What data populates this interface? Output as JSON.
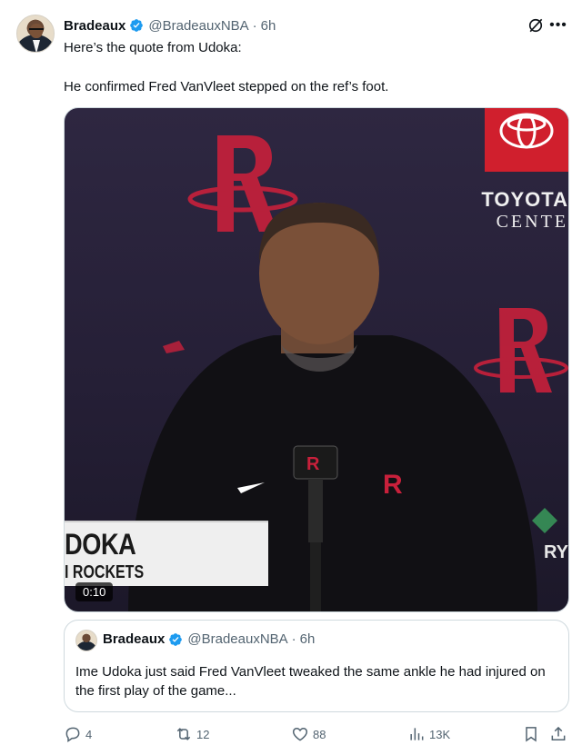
{
  "tweet": {
    "author": {
      "name": "Bradeaux",
      "handle": "@BradeauxNBA",
      "separator": "·",
      "time": "6h"
    },
    "text_line1": "Here’s the quote from Udoka:",
    "text_line2": "He confirmed Fred VanVleet stepped on the ref’s foot.",
    "media": {
      "duration": "0:10",
      "lower_third_name": "DOKA",
      "lower_third_team": "I ROCKETS",
      "sponsor_line1": "TOYOTA",
      "sponsor_line2": "CENTE",
      "right_edge_text": "RY"
    },
    "quote": {
      "name": "Bradeaux",
      "handle": "@BradeauxNBA",
      "separator": "·",
      "time": "6h",
      "text": "Ime Udoka just said Fred VanVleet tweaked the same ankle he had injured on the first play of the game..."
    },
    "actions": {
      "replies": "4",
      "reposts": "12",
      "likes": "88",
      "views": "13K"
    }
  },
  "colors": {
    "accent_blue": "#1d9bf0",
    "muted_gray": "#536471",
    "border": "#cfd9de",
    "rockets_red": "#ce1141"
  },
  "icons": [
    "verified-badge-icon",
    "grok-icon",
    "more-icon",
    "reply-icon",
    "repost-icon",
    "like-icon",
    "views-icon",
    "bookmark-icon",
    "share-icon"
  ]
}
